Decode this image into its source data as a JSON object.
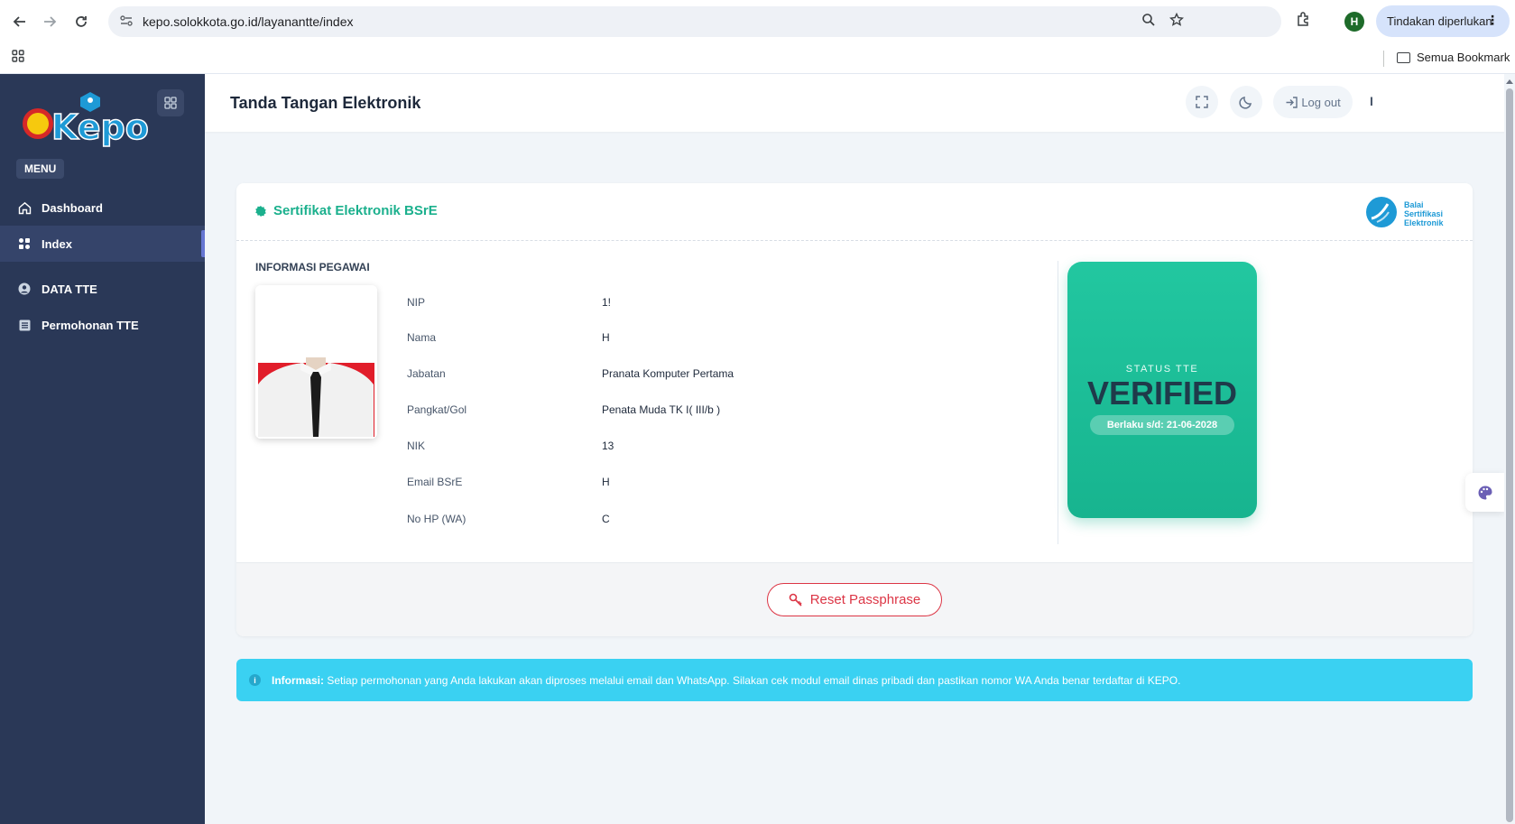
{
  "browser": {
    "url": "kepo.solokkota.go.id/layanantte/index",
    "profile_initial": "H",
    "action_label": "Tindakan diperlukan",
    "bookmark_folder": "Semua Bookmark"
  },
  "sidebar": {
    "logo_text": "Kepo",
    "menu_label": "MENU",
    "items": [
      {
        "label": "Dashboard",
        "icon": "home-icon"
      },
      {
        "label": "Index",
        "icon": "grid-icon"
      },
      {
        "label": "DATA TTE",
        "icon": "user-circle-icon"
      },
      {
        "label": "Permohonan TTE",
        "icon": "list-icon"
      }
    ]
  },
  "header": {
    "title": "Tanda Tangan Elektronik",
    "logout_label": "Log out",
    "more_label": "I"
  },
  "card": {
    "title": "Sertifikat Elektronik BSrE",
    "bsre_logo_lines": [
      "Balai",
      "Sertifikasi",
      "Elektronik"
    ],
    "section_label": "INFORMASI PEGAWAI",
    "fields": [
      {
        "label": "NIP",
        "value": "1!"
      },
      {
        "label": "Nama",
        "value": "H"
      },
      {
        "label": "Jabatan",
        "value": "Pranata Komputer Pertama"
      },
      {
        "label": "Pangkat/Gol",
        "value": "Penata Muda TK I( III/b )"
      },
      {
        "label": "NIK",
        "value": "13"
      },
      {
        "label": "Email BSrE",
        "value": "H"
      },
      {
        "label": "No HP (WA)",
        "value": "C"
      }
    ],
    "status": {
      "label": "STATUS TTE",
      "value": "VERIFIED",
      "valid_until": "Berlaku s/d: 21-06-2028"
    },
    "reset_button": "Reset Passphrase"
  },
  "banner": {
    "prefix": "Informasi:",
    "text": "Setiap permohonan yang Anda lakukan akan diproses melalui email dan WhatsApp. Silakan cek modul email dinas pribadi dan pastikan nomor WA Anda benar terdaftar di KEPO."
  },
  "colors": {
    "sidebar_bg": "#2a3857",
    "accent_green": "#1bb08d",
    "danger": "#dc3545",
    "info": "#3ad1f2"
  }
}
